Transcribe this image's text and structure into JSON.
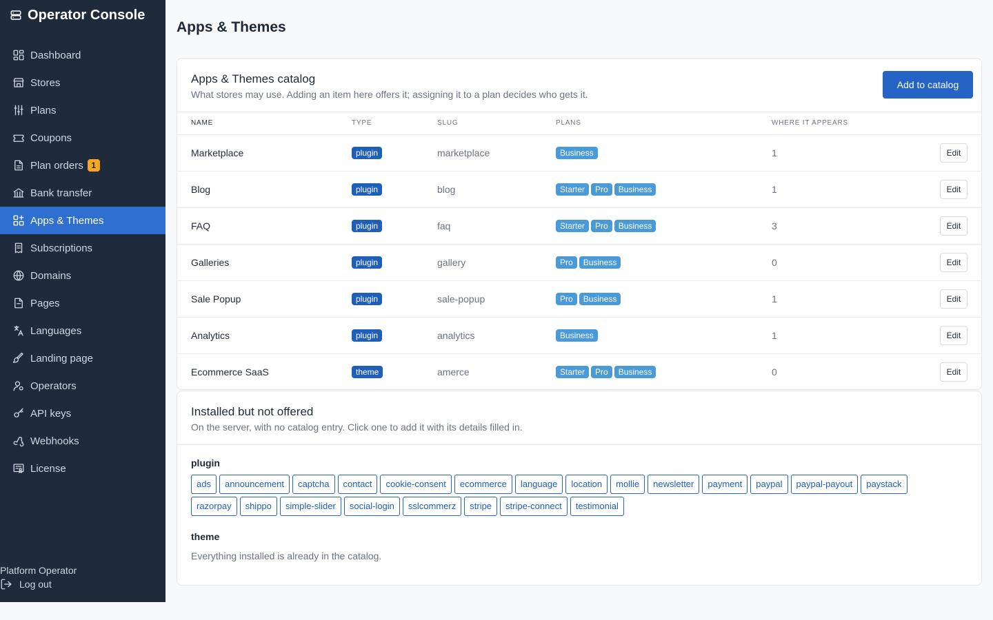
{
  "sidebar": {
    "brand": "Operator Console",
    "items": [
      {
        "label": "Dashboard",
        "icon": "dashboard-icon"
      },
      {
        "label": "Stores",
        "icon": "store-icon"
      },
      {
        "label": "Plans",
        "icon": "sliders-icon"
      },
      {
        "label": "Coupons",
        "icon": "ticket-icon"
      },
      {
        "label": "Plan orders",
        "icon": "file-icon",
        "badge": "1"
      },
      {
        "label": "Bank transfer",
        "icon": "bank-icon"
      },
      {
        "label": "Apps & Themes",
        "icon": "apps-icon",
        "active": true
      },
      {
        "label": "Subscriptions",
        "icon": "receipt-icon"
      },
      {
        "label": "Domains",
        "icon": "globe-icon"
      },
      {
        "label": "Pages",
        "icon": "page-icon"
      },
      {
        "label": "Languages",
        "icon": "translate-icon"
      },
      {
        "label": "Landing page",
        "icon": "brush-icon"
      },
      {
        "label": "Operators",
        "icon": "user-icon"
      },
      {
        "label": "API keys",
        "icon": "key-icon"
      },
      {
        "label": "Webhooks",
        "icon": "webhook-icon"
      },
      {
        "label": "License",
        "icon": "license-icon"
      }
    ],
    "footer": {
      "user": "Platform Operator",
      "logout": "Log out"
    }
  },
  "page": {
    "title": "Apps & Themes"
  },
  "catalog": {
    "title": "Apps & Themes catalog",
    "subtitle": "What stores may use. Adding an item here offers it; assigning it to a plan decides who gets it.",
    "add_button": "Add to catalog",
    "columns": [
      "NAME",
      "TYPE",
      "SLUG",
      "PLANS",
      "WHERE IT APPEARS",
      ""
    ],
    "edit_label": "Edit",
    "rows": [
      {
        "name": "Marketplace",
        "type": "plugin",
        "slug": "marketplace",
        "plans": [
          "Business"
        ],
        "where": "1"
      },
      {
        "name": "Blog",
        "type": "plugin",
        "slug": "blog",
        "plans": [
          "Starter",
          "Pro",
          "Business"
        ],
        "where": "1"
      },
      {
        "name": "FAQ",
        "type": "plugin",
        "slug": "faq",
        "plans": [
          "Starter",
          "Pro",
          "Business"
        ],
        "where": "3"
      },
      {
        "name": "Galleries",
        "type": "plugin",
        "slug": "gallery",
        "plans": [
          "Pro",
          "Business"
        ],
        "where": "0"
      },
      {
        "name": "Sale Popup",
        "type": "plugin",
        "slug": "sale-popup",
        "plans": [
          "Pro",
          "Business"
        ],
        "where": "1"
      },
      {
        "name": "Analytics",
        "type": "plugin",
        "slug": "analytics",
        "plans": [
          "Business"
        ],
        "where": "1"
      },
      {
        "name": "Ecommerce SaaS",
        "type": "theme",
        "slug": "amerce",
        "plans": [
          "Starter",
          "Pro",
          "Business"
        ],
        "where": "0"
      }
    ]
  },
  "installed": {
    "title": "Installed but not offered",
    "subtitle": "On the server, with no catalog entry. Click one to add it with its details filled in.",
    "plugin_heading": "plugin",
    "plugins": [
      "ads",
      "announcement",
      "captcha",
      "contact",
      "cookie-consent",
      "ecommerce",
      "language",
      "location",
      "mollie",
      "newsletter",
      "payment",
      "paypal",
      "paypal-payout",
      "paystack",
      "razorpay",
      "shippo",
      "simple-slider",
      "social-login",
      "sslcommerz",
      "stripe",
      "stripe-connect",
      "testimonial"
    ],
    "theme_heading": "theme",
    "theme_note": "Everything installed is already in the catalog."
  },
  "colors": {
    "sidebar_bg": "#1f2a3a",
    "accent": "#2563c4",
    "active_nav": "#2f6fd0",
    "badge": "#f5a623",
    "plan_badge": "#4b9ad8"
  }
}
